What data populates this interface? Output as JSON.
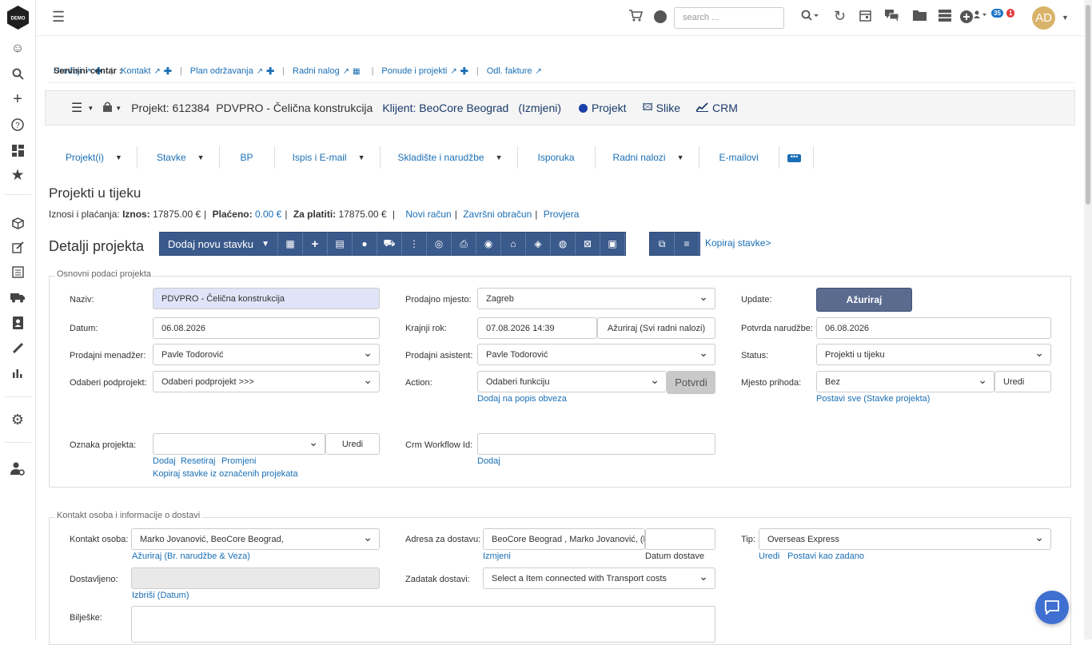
{
  "app": {
    "logo_text": "DEMO",
    "avatar_initials": "AD"
  },
  "topbar": {
    "search_placeholder": "search ...",
    "badge_users": "35",
    "badge_alerts": "1"
  },
  "service_center": {
    "label": "Servisni centar :",
    "links": [
      "Uređaji",
      "Kontakt",
      "Plan održavanja",
      "Radni nalog",
      "Ponude i projekti",
      "Odl. fakture"
    ]
  },
  "project_bar": {
    "project": "Projekt: 612384",
    "name": "PDVPRO - Čelična konstrukcija",
    "client": "Klijent: BeoCore Beograd",
    "change": "(Izmjeni)",
    "m_projekt": "Projekt",
    "m_slike": "Slike",
    "m_crm": "CRM"
  },
  "tabs": [
    "Projekt(i)",
    "Stavke",
    "BP",
    "Ispis i E-mail",
    "Skladište i narudžbe",
    "Isporuka",
    "Radni nalozi",
    "E-mailovi"
  ],
  "status_title": "Projekti u tijeku",
  "amounts": {
    "prefix": "Iznosi i plaćanja:",
    "iznos_label": "Iznos:",
    "iznos": "17875.00 €",
    "placeno_label": "Plaćeno:",
    "placeno": "0.00 €",
    "zaplatiti_label": "Za platiti:",
    "zaplatiti": "17875.00 €",
    "links": [
      "Novi račun",
      "Završni obračun",
      "Provjera"
    ]
  },
  "details": {
    "title": "Detalji projekta",
    "add_item": "Dodaj novu stavku",
    "copy_items": "Kopiraj stavke>"
  },
  "basic": {
    "legend": "Osnovni podaci projekta",
    "naziv_label": "Naziv:",
    "naziv": "PDVPRO - Čelična konstrukcija",
    "datum_label": "Datum:",
    "datum": "06.08.2026",
    "menadzer_label": "Prodajni menadžer:",
    "menadzer": "Pavle Todorović",
    "podprojekt_label": "Odaberi podprojekt:",
    "podprojekt": "Odaberi podprojekt >>>",
    "oznaka_label": "Oznaka projekta:",
    "oznaka_uredi": "Uredi",
    "oznaka_links": [
      "Dodaj",
      "Resetiraj",
      "Promjeni"
    ],
    "oznaka_copy": "Kopiraj stavke iz označenih projekata",
    "mjesto_label": "Prodajno mjesto:",
    "mjesto": "Zagreb",
    "rok_label": "Krajnji rok:",
    "rok": "07.08.2026 14:39",
    "rok_btn": "Ažuriraj (Svi radni nalozi)",
    "asistent_label": "Prodajni asistent:",
    "asistent": "Pavle Todorović",
    "action_label": "Action:",
    "action": "Odaberi funkciju",
    "action_btn": "Potvrdi",
    "action_link": "Dodaj na popis obveza",
    "crm_label": "Crm Workflow Id:",
    "crm_link": "Dodaj",
    "update_label": "Update:",
    "update_btn": "Ažuriraj",
    "potvrda_label": "Potvrda narudžbe:",
    "potvrda": "06.08.2026",
    "status_label": "Status:",
    "status": "Projekti u tijeku",
    "prihod_label": "Mjesto prihoda:",
    "prihod": "Bez",
    "prihod_uredi": "Uredi",
    "prihod_link": "Postavi sve (Stavke projekta)"
  },
  "contact": {
    "legend": "Kontakt osoba i informacije o dostavi",
    "osoba_label": "Kontakt osoba:",
    "osoba": "Marko Jovanović, BeoCore Beograd,",
    "osoba_link": "Ažuriraj (Br. narudžbe & Veza)",
    "dostavljeno_label": "Dostavljeno:",
    "dostavljeno_link": "Izbriši (Datum)",
    "biljeske_label": "Bilješke:",
    "adresa_label": "Adresa za dostavu:",
    "adresa": "BeoCore Beograd , Marko Jovanović, (M",
    "adresa_link": "Izmjeni",
    "datum_dostave": "Datum dostave",
    "zadatak_label": "Zadatak dostavi:",
    "zadatak": "Select a Item connected with Transport costs",
    "tip_label": "Tip:",
    "tip": "Overseas Express",
    "tip_links": [
      "Uredi",
      "Postavi kao zadano"
    ]
  }
}
